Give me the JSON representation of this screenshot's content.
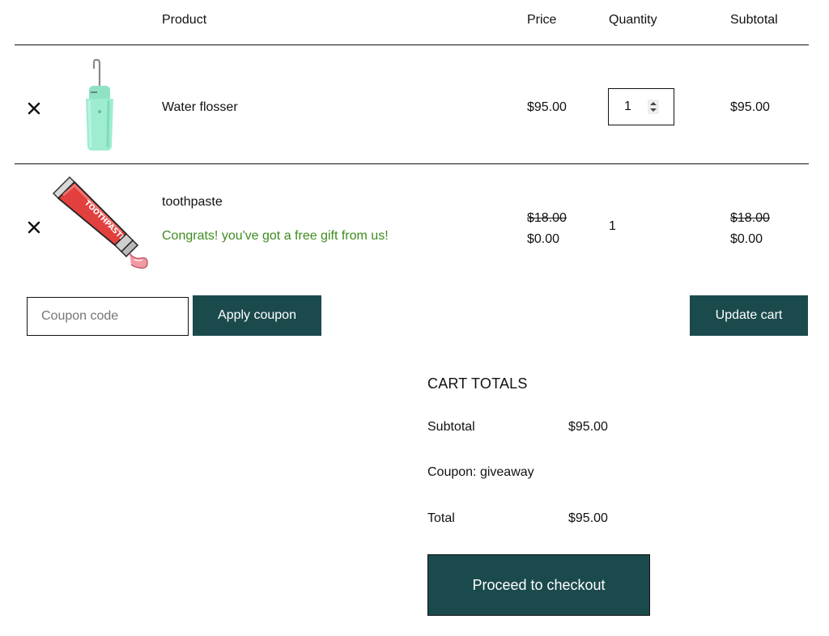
{
  "cart": {
    "headers": {
      "product": "Product",
      "price": "Price",
      "quantity": "Quantity",
      "subtotal": "Subtotal"
    },
    "items": [
      {
        "remove_icon": "close-icon",
        "thumbnail": "water-flosser-image",
        "name": "Water flosser",
        "price": "$95.00",
        "quantity": "1",
        "subtotal": "$95.00"
      },
      {
        "remove_icon": "close-icon",
        "thumbnail": "toothpaste-image",
        "name": "toothpaste",
        "note": "Congrats! you've got a free gift from us!",
        "price_original": "$18.00",
        "price": "$0.00",
        "quantity": "1",
        "subtotal_original": "$18.00",
        "subtotal": "$0.00"
      }
    ]
  },
  "actions": {
    "coupon_placeholder": "Coupon code",
    "apply_coupon_label": "Apply coupon",
    "update_cart_label": "Update cart"
  },
  "totals": {
    "heading": "CART TOTALS",
    "subtotal_label": "Subtotal",
    "subtotal_value": "$95.00",
    "coupon_label": "Coupon: giveaway",
    "total_label": "Total",
    "total_value": "$95.00",
    "checkout_label": "Proceed to checkout"
  },
  "colors": {
    "button_bg": "#1b4a4d",
    "button_text": "#ffffff",
    "gift_note": "#3e8c1f",
    "border": "#111111"
  }
}
